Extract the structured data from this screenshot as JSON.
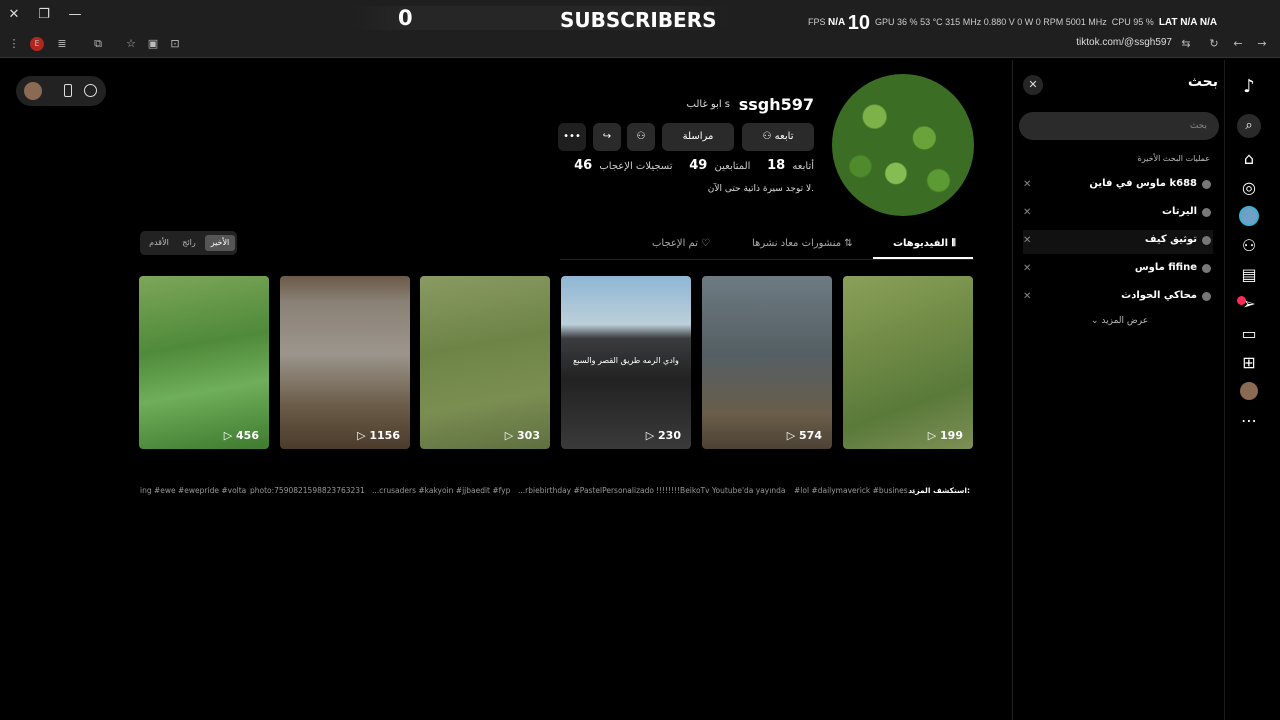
{
  "overlay": {
    "subscriber_count": "0",
    "subscriber_label": "SUBSCRIBERS",
    "fps_label": "FPS",
    "fps_value": "N/A",
    "fps_big": "10",
    "gpu_stats": "GPU 36 % 53 °C 315 MHz 0.880 V 0 W 0 RPM 5001 MHz",
    "cpu_stats": "CPU 95 %",
    "lat_stats": "LAT N/A N/A"
  },
  "browser": {
    "url": "tiktok.com/@ssgh597"
  },
  "search_panel": {
    "title": "بحث",
    "placeholder": "بحث",
    "recent_label": "عمليات البحث الأخيرة",
    "items": [
      "ماوس في فاين k688",
      "اليرتات",
      "توثيق كيف",
      "ماوس fifine",
      "محاكي الحوادث"
    ],
    "more": "عرض المزيد"
  },
  "profile": {
    "username": "ssgh597",
    "nickname": "ابو غالب s",
    "follow_button": "تابعه",
    "message_button": "مراسلة",
    "following_count": "18",
    "following_label": "أتابعه",
    "followers_count": "49",
    "followers_label": "المتابعين",
    "likes_count": "46",
    "likes_label": "تسجيلات الإعجاب",
    "bio": "لا توجد سيرة ذاتية حتى الآن."
  },
  "tabs": {
    "videos": "الفيديوهات",
    "reposts": "منشورات معاد نشرها",
    "liked": "تم الإعجاب"
  },
  "sort": {
    "latest": "الأخير",
    "popular": "رائج",
    "oldest": "الأقدم"
  },
  "videos": [
    {
      "views": "199",
      "caption": ""
    },
    {
      "views": "574",
      "caption": ""
    },
    {
      "views": "230",
      "caption": "وادي الرمه طريق القصر والسبع"
    },
    {
      "views": "303",
      "caption": ""
    },
    {
      "views": "1156",
      "caption": ""
    },
    {
      "views": "456",
      "caption": ""
    }
  ],
  "explore": {
    "label": "استكشف المزيد:",
    "tags": [
      "#lol #dailymaverick #busines...",
      "!!!!!!!!BeikoTv Youtube'da yayında",
      "...rbiebirthday #PastelPersonalizado",
      "...crusaders #kakyoin #jjbaedit #fyp",
      "photo:7590821598823763231",
      "ing #ewe #ewepride #volta"
    ]
  }
}
